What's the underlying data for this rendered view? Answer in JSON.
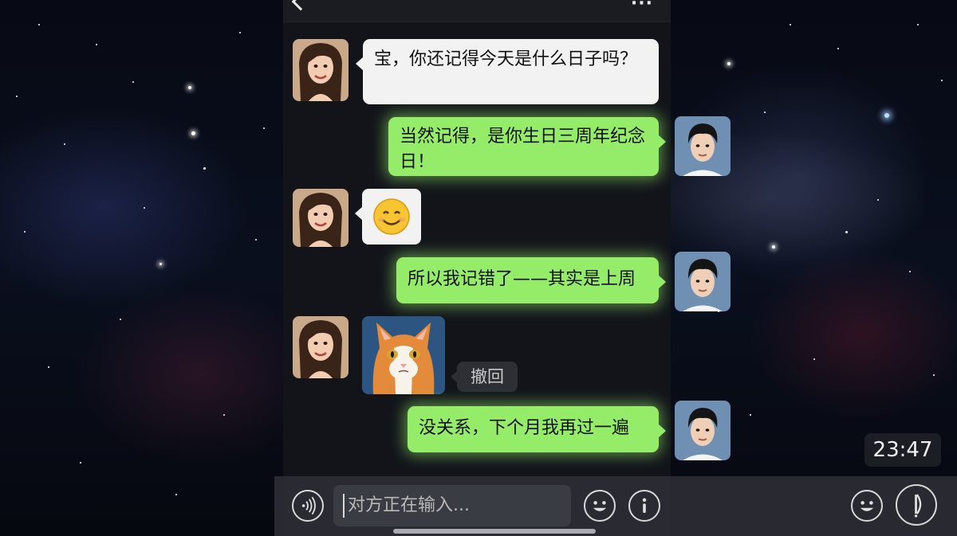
{
  "chat": {
    "messages": [
      {
        "side": "left",
        "type": "text",
        "text": "宝，你还记得今天是什么日子吗？"
      },
      {
        "side": "right",
        "type": "text",
        "text": "当然记得，是你生日三周年纪念日！"
      },
      {
        "side": "left",
        "type": "emoji",
        "icon": "smiling-face-emoji"
      },
      {
        "side": "right",
        "type": "text",
        "text": "所以我记错了——其实是上周"
      },
      {
        "side": "left",
        "type": "image",
        "icon": "cat-photo",
        "recall_label": "撤回"
      },
      {
        "side": "right",
        "type": "text",
        "text": "没关系，下个月我再过一遍"
      }
    ]
  },
  "input": {
    "placeholder": "对方正在输入...",
    "voice_icon": "voice-icon",
    "emoji_icon": "emoji-icon",
    "more_icon": "more-options-icon"
  },
  "overlay": {
    "time": "23:47"
  },
  "colors": {
    "bubble_green": "#95ec69",
    "bubble_white": "#f2f2f2",
    "chat_background": "#12141a"
  }
}
